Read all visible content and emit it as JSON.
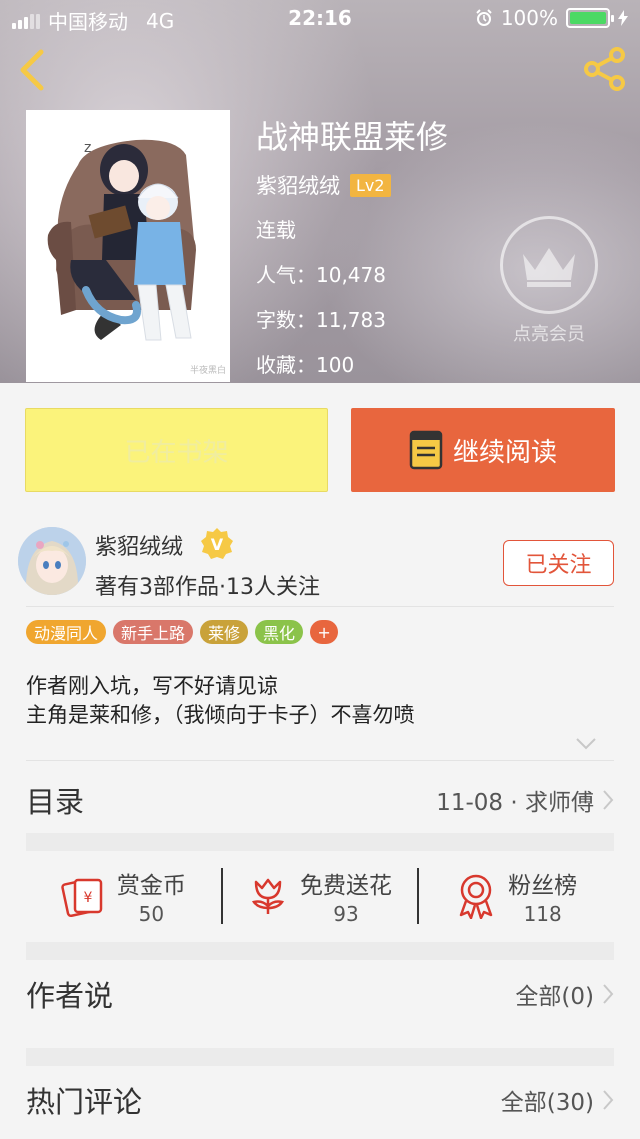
{
  "status": {
    "carrier": "中国移动",
    "network": "4G",
    "time": "22:16",
    "battery": "100%"
  },
  "book": {
    "title": "战神联盟莱修",
    "author": "紫貂绒绒",
    "level": "Lv2",
    "status": "连载",
    "popularity": "人气：10,478",
    "words": "字数：11,783",
    "favorites": "收藏：100",
    "cover_caption": "半夜黑白"
  },
  "vip": {
    "label": "点亮会员"
  },
  "actions": {
    "shelf_label": "已在书架",
    "read_label": "继续阅读"
  },
  "author_card": {
    "name": "紫貂绒绒",
    "subtitle": "著有3部作品·13人关注",
    "follow_label": "已关注",
    "badge": "V"
  },
  "tags": [
    {
      "label": "动漫同人",
      "color": "#f0a62f"
    },
    {
      "label": "新手上路",
      "color": "#d9776a"
    },
    {
      "label": "莱修",
      "color": "#c9a23a"
    },
    {
      "label": "黑化",
      "color": "#8bc34a"
    },
    {
      "label": "+",
      "color": "#e8663e"
    }
  ],
  "description": {
    "line1": "作者刚入坑，写不好请见谅",
    "line2": "主角是莱和修，（我倾向于卡子）不喜勿喷"
  },
  "catalog": {
    "title": "目录",
    "latest": "11-08 · 求师傅"
  },
  "stats": [
    {
      "label": "赏金币",
      "value": "50",
      "icon": "red-envelope-icon"
    },
    {
      "label": "免费送花",
      "value": "93",
      "icon": "flower-icon"
    },
    {
      "label": "粉丝榜",
      "value": "118",
      "icon": "medal-icon"
    }
  ],
  "author_says": {
    "title": "作者说",
    "count": "全部(0)"
  },
  "hot_comments": {
    "title": "热门评论",
    "count": "全部(30)"
  },
  "colors": {
    "accent": "#e8663e",
    "shelf": "#fbf37b",
    "follow": "#e2553a"
  }
}
